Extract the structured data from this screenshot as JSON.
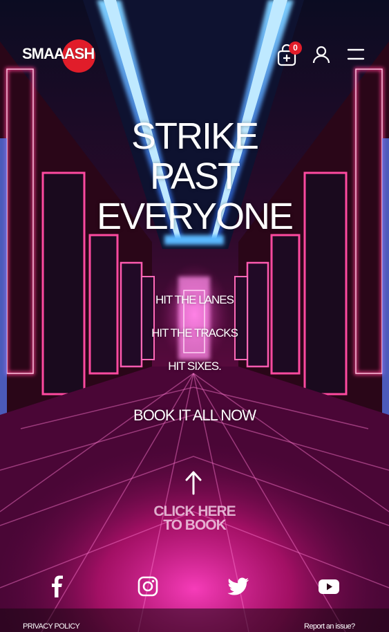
{
  "brand": {
    "logo_text": "SMAAASH"
  },
  "header": {
    "cart_count": "0"
  },
  "hero": {
    "headline": [
      "STRIKE",
      "PAST",
      "EVERYONE"
    ],
    "taglines": [
      "HIT THE LANES",
      "HIT THE TRACKS",
      "HIT SIXES."
    ],
    "cta": "BOOK IT ALL NOW",
    "book_link": [
      "CLICK HERE",
      "TO BOOK"
    ]
  },
  "social": {
    "icons": [
      "facebook-icon",
      "instagram-icon",
      "twitter-icon",
      "youtube-icon"
    ]
  },
  "footer": {
    "privacy": "PRIVACY POLICY",
    "report": "Report an issue?"
  },
  "colors": {
    "accent_red": "#e11d2a",
    "neon_pink": "#ff2fa8",
    "neon_blue": "#3fa0ff",
    "background": "#140611"
  }
}
